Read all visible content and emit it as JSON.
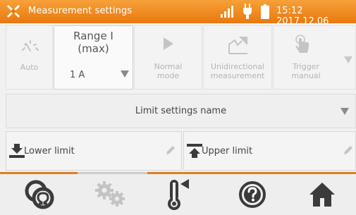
{
  "status_bar": {
    "title": "Measurement settings",
    "clock": "15:12 2017.12.06",
    "icons": [
      "measurement-settings-icon",
      "signal-icon",
      "power-plug-icon",
      "battery-icon"
    ]
  },
  "tiles": {
    "auto": {
      "label": "Auto"
    },
    "range": {
      "title": "Range I\n(max)",
      "value": "1 A"
    },
    "normal_mode": {
      "label": "Normal\nmode"
    },
    "unidirectional": {
      "label": "Unidirectional\nmeasurement"
    },
    "trigger": {
      "label": "Trigger\nmanual"
    }
  },
  "limit_settings_name": {
    "label": "Limit settings name"
  },
  "lower_limit": {
    "label": "Lower limit"
  },
  "upper_limit": {
    "label": "Upper limit"
  },
  "bottom_bar": {
    "icons": [
      "measurement-function-icon",
      "settings-gears-icon",
      "temperature-icon",
      "help-icon",
      "home-icon"
    ]
  },
  "colors": {
    "accent": "#e8780e",
    "status_bar_top": "#f7a13a",
    "icon_dark": "#3b3b3b",
    "disabled": "#c4c4c4"
  }
}
